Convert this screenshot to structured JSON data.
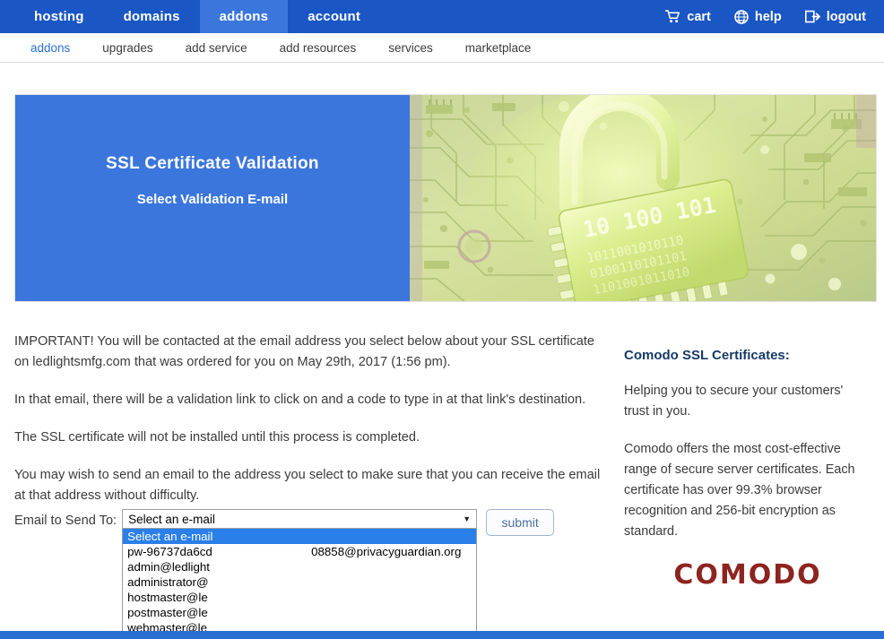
{
  "topnav": {
    "tabs": [
      {
        "label": "hosting",
        "active": false
      },
      {
        "label": "domains",
        "active": false
      },
      {
        "label": "addons",
        "active": true
      },
      {
        "label": "account",
        "active": false
      }
    ],
    "actions": [
      {
        "label": "cart",
        "icon": "shopping-cart-icon"
      },
      {
        "label": "help",
        "icon": "help-globe-icon"
      },
      {
        "label": "logout",
        "icon": "logout-icon"
      }
    ],
    "background_color": "#1a56c4",
    "active_tab_color": "#3b76dd"
  },
  "subnav": {
    "items": [
      {
        "label": "addons",
        "active": true
      },
      {
        "label": "upgrades",
        "active": false
      },
      {
        "label": "add service",
        "active": false
      },
      {
        "label": "add resources",
        "active": false
      },
      {
        "label": "services",
        "active": false
      },
      {
        "label": "marketplace",
        "active": false
      }
    ],
    "active_color": "#2a6ed4"
  },
  "banner": {
    "title": "SSL Certificate Validation",
    "subtitle": "Select Validation E-mail",
    "background_color": "#3b76dd",
    "image_alt": "padlock-circuit-board-image"
  },
  "main": {
    "paragraphs": [
      "IMPORTANT! You will be contacted at the email address you select below about your SSL certificate on ledlightsmfg.com that was ordered for you on May 29th, 2017 (1:56 pm).",
      "In that email, there will be a validation link to click on and a code to type in at that link's destination.",
      "The SSL certificate will not be installed until this process is completed.",
      "You may wish to send an email to the address you select to make sure that you can receive the email at that address without difficulty."
    ],
    "domain": "ledlightsmfg.com",
    "order_date": "May 29th, 2017 (1:56 pm)"
  },
  "form": {
    "label": "Email to Send To:",
    "select_value": "Select an e-mail",
    "caret_icon": "chevron-down-icon",
    "submit_label": "submit",
    "dropdown_open": true,
    "options": [
      {
        "text": "Select an e-mail",
        "tail": "",
        "selected": true
      },
      {
        "text": "pw-96737da6cd",
        "tail": "08858@privacyguardian.org",
        "selected": false
      },
      {
        "text": "admin@ledlight",
        "tail": "",
        "selected": false
      },
      {
        "text": "administrator@",
        "tail": "",
        "selected": false
      },
      {
        "text": "hostmaster@le",
        "tail": "",
        "selected": false
      },
      {
        "text": "postmaster@le",
        "tail": "",
        "selected": false
      },
      {
        "text": "webmaster@le",
        "tail": "",
        "selected": false
      }
    ]
  },
  "sidebar": {
    "heading": "Comodo SSL Certificates:",
    "paragraphs": [
      "Helping you to secure your customers' trust in you.",
      "Comodo offers the most cost-effective range of secure server certificates. Each certificate has over 99.3% browser recognition and 256-bit encryption as standard."
    ],
    "logo_text": "COMODO",
    "logo_color": "#8e2420",
    "heading_color": "#173a66"
  },
  "footer": {
    "color": "#2a6ed4"
  }
}
